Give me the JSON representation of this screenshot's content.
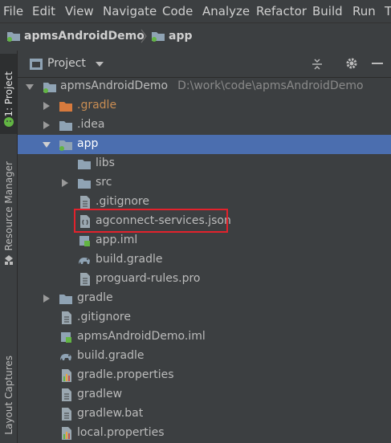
{
  "menu": [
    "File",
    "Edit",
    "View",
    "Navigate",
    "Code",
    "Analyze",
    "Refactor",
    "Build",
    "Run",
    "T"
  ],
  "breadcrumb": {
    "project": "apmsAndroidDemo",
    "module": "app"
  },
  "toolstrip": {
    "project_tab": "1: Project",
    "resource_tab": "Resource Manager",
    "layout_tab": "Layout Captures"
  },
  "panel": {
    "title": "Project"
  },
  "tree": [
    {
      "label": "apmsAndroidDemo",
      "path": "D:\\work\\code\\apmsAndroidDemo",
      "icon": "module-folder-icon",
      "expanded": true
    },
    {
      "label": ".gradle",
      "icon": "folder-orange-icon",
      "expanded": false
    },
    {
      "label": ".idea",
      "icon": "folder-icon",
      "expanded": false
    },
    {
      "label": "app",
      "icon": "module-folder-icon",
      "expanded": true,
      "selected": true
    },
    {
      "label": "libs",
      "icon": "folder-icon"
    },
    {
      "label": "src",
      "icon": "folder-icon",
      "expanded": false
    },
    {
      "label": ".gitignore",
      "icon": "text-file-icon"
    },
    {
      "label": "agconnect-services.json",
      "icon": "json-file-icon",
      "highlighted": true
    },
    {
      "label": "app.iml",
      "icon": "iml-file-icon"
    },
    {
      "label": "build.gradle",
      "icon": "gradle-icon"
    },
    {
      "label": "proguard-rules.pro",
      "icon": "text-file-icon"
    },
    {
      "label": "gradle",
      "icon": "folder-icon",
      "expanded": false
    },
    {
      "label": ".gitignore",
      "icon": "text-file-icon"
    },
    {
      "label": "apmsAndroidDemo.iml",
      "icon": "iml-file-icon"
    },
    {
      "label": "build.gradle",
      "icon": "gradle-icon"
    },
    {
      "label": "gradle.properties",
      "icon": "properties-file-icon"
    },
    {
      "label": "gradlew",
      "icon": "text-file-icon"
    },
    {
      "label": "gradlew.bat",
      "icon": "text-file-icon"
    },
    {
      "label": "local.properties",
      "icon": "properties-file-icon"
    }
  ],
  "colors": {
    "selection": "#4b6eaf",
    "highlight_box": "#e2222c",
    "folder": "#8fa3b4",
    "orange_folder": "#d77a3d",
    "module_dot": "#62b543"
  }
}
